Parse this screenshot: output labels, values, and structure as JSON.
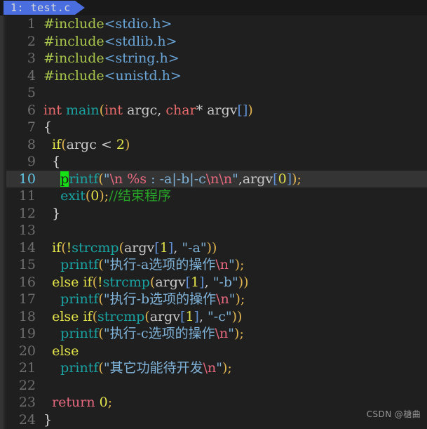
{
  "window": {
    "app": "vim-code-editor",
    "theme_background": "#1f1f1f"
  },
  "tabbar": {
    "tabs": [
      {
        "label": "1: test.c",
        "active": true
      }
    ]
  },
  "watermark": {
    "text": "CSDN @榶曲"
  },
  "colors": {
    "preprocessor": "#a9c64c",
    "header": "#6aa5d8",
    "type": "#e86a6a",
    "function": "#1aa3a3",
    "punctuation": "#e0b450",
    "keyword": "#e3e34a",
    "return": "#e8697f",
    "plain": "#c9c9c9",
    "number": "#e3e34a",
    "bracket": "#5f8fd0",
    "string": "#7fb2d8",
    "escape": "#e8697f",
    "comment": "#28a428",
    "cursor": "#16e016",
    "tab_active": "#4a6ee0",
    "current_line_bg": "#343434",
    "current_line_number": "#63c8e8",
    "line_number": "#6e6e6e"
  },
  "editor": {
    "cursor_line": 10,
    "cursor_column": 1,
    "language": "c",
    "lines": [
      {
        "n": "1",
        "text": "#include<stdio.h>"
      },
      {
        "n": "2",
        "text": "#include<stdlib.h>"
      },
      {
        "n": "3",
        "text": "#include<string.h>"
      },
      {
        "n": "4",
        "text": "#include<unistd.h>"
      },
      {
        "n": "5",
        "text": ""
      },
      {
        "n": "6",
        "text": "int main(int argc, char* argv[])"
      },
      {
        "n": "7",
        "text": "{"
      },
      {
        "n": "8",
        "text": "  if(argc < 2)"
      },
      {
        "n": "9",
        "text": "  {"
      },
      {
        "n": "10",
        "text": "    printf(\"\\n %s : -a|-b|-c\\n\\n\",argv[0]);"
      },
      {
        "n": "11",
        "text": "    exit(0);//结束程序"
      },
      {
        "n": "12",
        "text": "  }"
      },
      {
        "n": "13",
        "text": ""
      },
      {
        "n": "14",
        "text": "  if(!strcmp(argv[1], \"-a\"))"
      },
      {
        "n": "15",
        "text": "    printf(\"执行-a选项的操作\\n\");"
      },
      {
        "n": "16",
        "text": "  else if(!strcmp(argv[1], \"-b\"))"
      },
      {
        "n": "17",
        "text": "    printf(\"执行-b选项的操作\\n\");"
      },
      {
        "n": "18",
        "text": "  else if(strcmp(argv[1], \"-c\"))"
      },
      {
        "n": "19",
        "text": "    printf(\"执行-c选项的操作\\n\");"
      },
      {
        "n": "20",
        "text": "  else"
      },
      {
        "n": "21",
        "text": "    printf(\"其它功能待开发\\n\");"
      },
      {
        "n": "22",
        "text": ""
      },
      {
        "n": "23",
        "text": "  return 0;"
      },
      {
        "n": "24",
        "text": "}"
      }
    ]
  }
}
